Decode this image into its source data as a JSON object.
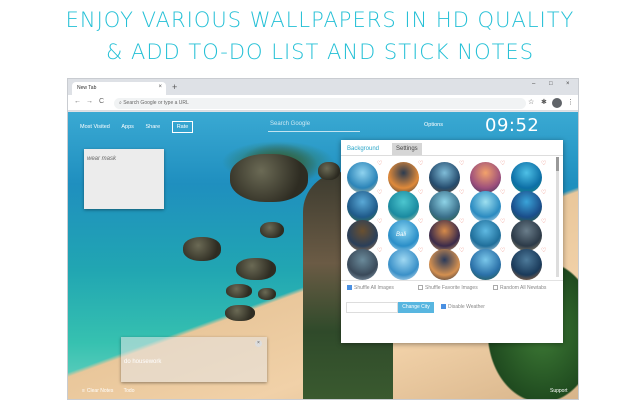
{
  "headline": {
    "line1": "ENJOY VARIOUS WALLPAPERS IN HD QUALITY",
    "line2": "& ADD TO-DO LIST AND STICK NOTES",
    "color": "#25c0d6"
  },
  "browser": {
    "tab_title": "New Tab",
    "tab_close": "×",
    "new_tab": "+",
    "window_controls": [
      "–",
      "□",
      "×"
    ],
    "nav": [
      "←",
      "→",
      "C"
    ],
    "address_placeholder": "Search Google or type a URL",
    "toolbar_icons": [
      "star-icon",
      "extensions-icon",
      "menu-icon"
    ]
  },
  "page": {
    "top_nav": [
      "Most Visited",
      "Apps",
      "Share",
      "Rate"
    ],
    "search_placeholder": "Search Google",
    "options": "Options",
    "clock": "09:52",
    "note_top": "wear mask",
    "note_bottom": "do housework",
    "note_close": "×",
    "bottom_left": [
      "Clear Notes",
      "Todo"
    ],
    "bottom_left_icon": "≡",
    "support": "Support"
  },
  "panel": {
    "tabs": [
      "Background",
      "Settings"
    ],
    "heart": "♡",
    "options": [
      "Shuffle All Images",
      "Shuffle Favorite Images",
      "Random All Newtabs"
    ],
    "shuffle_all_checked": true,
    "change_city": "Change City",
    "disable_weather": "Disable Weather",
    "disable_weather_checked": true,
    "thumb_label": "Bali",
    "accent": "#29a5c8"
  }
}
